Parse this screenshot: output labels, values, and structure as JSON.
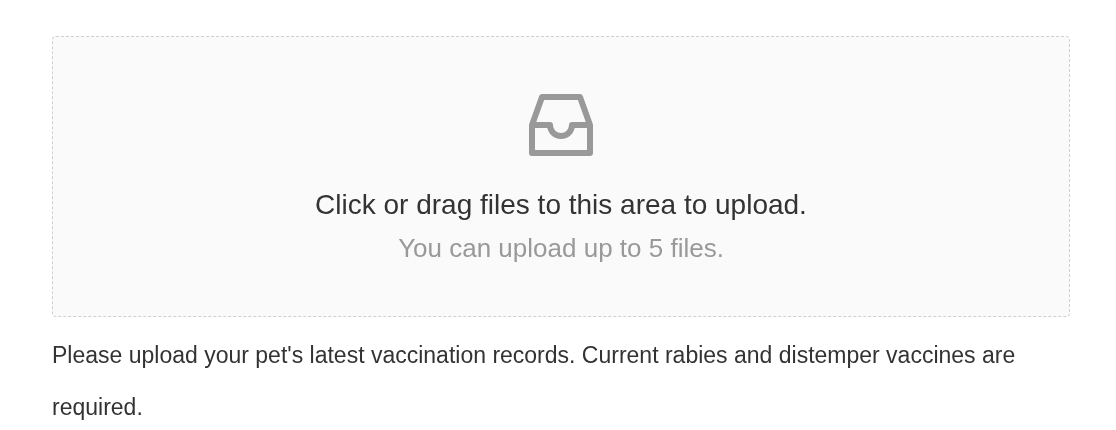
{
  "upload_area": {
    "title": "Click or drag files to this area to upload.",
    "hint": "You can upload up to 5 files."
  },
  "help_text": "Please upload your pet's latest vaccination records. Current rabies and distemper vaccines are required."
}
